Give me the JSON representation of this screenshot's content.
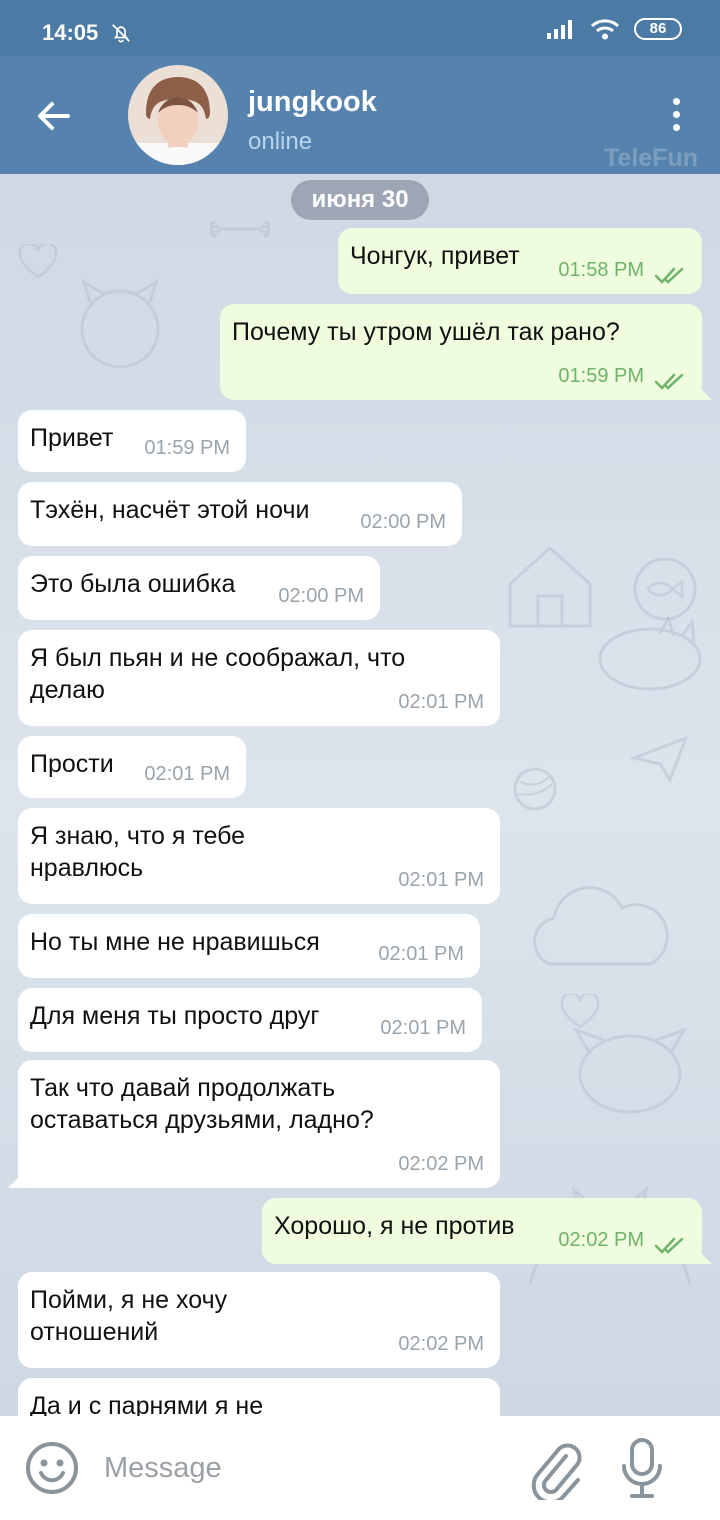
{
  "status_bar": {
    "time": "14:05",
    "battery": "86"
  },
  "header": {
    "title": "jungkook",
    "status": "online",
    "watermark": "TeleFun"
  },
  "chat": {
    "date": "июня 30",
    "messages": [
      {
        "dir": "out",
        "text": "Чонгук, привет",
        "time": "01:58 PM",
        "read": true
      },
      {
        "dir": "out",
        "text": "Почему ты утром ушёл так рано?",
        "time": "01:59 PM",
        "read": true
      },
      {
        "dir": "in",
        "text": "Привет",
        "time": "01:59 PM"
      },
      {
        "dir": "in",
        "text": "Тэхён, насчёт этой ночи",
        "time": "02:00 PM"
      },
      {
        "dir": "in",
        "text": "Это была ошибка",
        "time": "02:00 PM"
      },
      {
        "dir": "in",
        "text": "Я был пьян и не соображал, что делаю",
        "time": "02:01 PM"
      },
      {
        "dir": "in",
        "text": "Прости",
        "time": "02:01 PM"
      },
      {
        "dir": "in",
        "text": "Я знаю, что я тебе нравлюсь",
        "time": "02:01 PM"
      },
      {
        "dir": "in",
        "text": "Но ты мне не нравишься",
        "time": "02:01 PM"
      },
      {
        "dir": "in",
        "text": "Для меня ты просто друг",
        "time": "02:01 PM"
      },
      {
        "dir": "in",
        "text": "Так что давай продолжать оставаться друзьями, ладно?",
        "time": "02:02 PM"
      },
      {
        "dir": "out",
        "text": "Хорошо, я не против",
        "time": "02:02 PM",
        "read": true
      },
      {
        "dir": "in",
        "text": "Пойми, я не хочу отношений",
        "time": "02:02 PM"
      },
      {
        "dir": "in",
        "text": "Да и с парнями я не",
        "time": ""
      }
    ]
  },
  "input": {
    "placeholder": "Message"
  },
  "icons": {
    "back": "arrow-left-icon",
    "menu": "more-vertical-icon",
    "emoji": "smile-icon",
    "attach": "paperclip-icon",
    "mic": "microphone-icon"
  },
  "colors": {
    "header": "#5683ad",
    "status_bar": "#4b7aa5",
    "outgoing_bubble": "#effdde",
    "incoming_bubble": "#ffffff",
    "read_ticks": "#6fb36a"
  }
}
